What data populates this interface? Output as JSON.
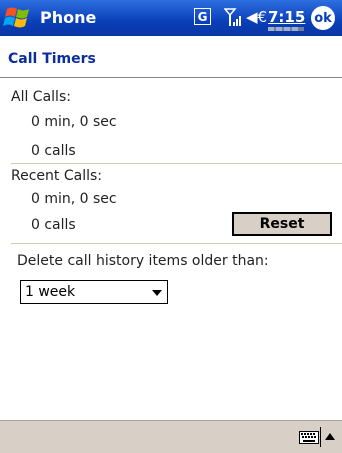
{
  "titlebar": {
    "app_title": "Phone",
    "gprs_label": "G",
    "clock": "7:15",
    "ok_label": "ok"
  },
  "page": {
    "title": "Call Timers"
  },
  "all_calls": {
    "label": "All Calls:",
    "duration": "0 min, 0 sec",
    "count": "0 calls"
  },
  "recent_calls": {
    "label": "Recent Calls:",
    "duration": "0 min, 0 sec",
    "count": "0 calls",
    "reset_label": "Reset"
  },
  "delete_history": {
    "label": "Delete call history items older than:",
    "selected": "1 week"
  },
  "colors": {
    "titlebar_blue": "#0a3fb8",
    "page_title_blue": "#0a2f9a",
    "bar_tan": "#d8d0c6"
  },
  "icons": [
    "windows-start-icon",
    "gprs-icon",
    "signal-icon",
    "volume-icon",
    "battery-icon",
    "keyboard-icon",
    "sip-arrow-icon"
  ]
}
